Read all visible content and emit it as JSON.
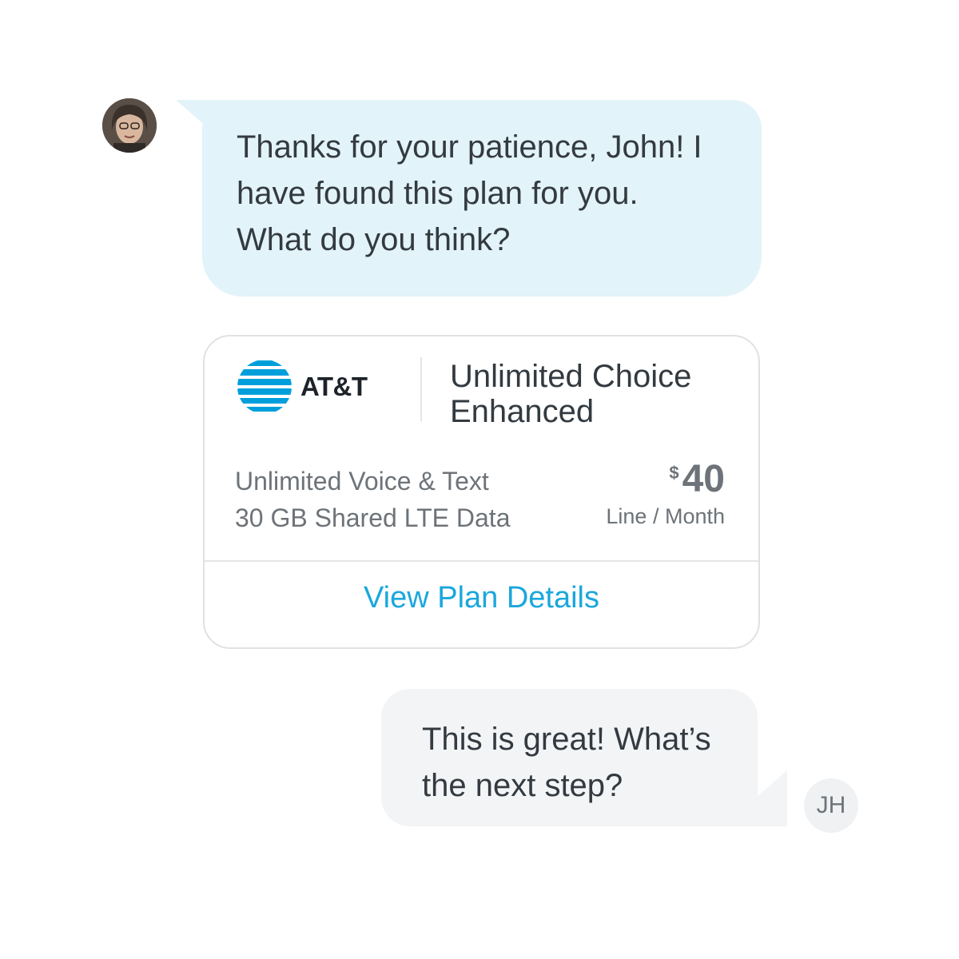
{
  "agent": {
    "avatar_icon": "agent-photo-avatar",
    "message": "Thanks for your patience, John! I have found this plan for you. What do you think?"
  },
  "plan_card": {
    "carrier_logo_icon": "att-globe-logo",
    "carrier_name": "AT&T",
    "plan_name": "Unlimited Choice Enhanced",
    "features": [
      "Unlimited Voice & Text",
      "30 GB Shared LTE Data"
    ],
    "price": {
      "currency": "$",
      "amount": "40",
      "unit": "Line / Month"
    },
    "details_link": "View Plan Details"
  },
  "user": {
    "message": "This is great! What’s the next step?",
    "initials": "JH"
  },
  "colors": {
    "agent_bubble": "#e2f3f9",
    "user_bubble": "#f3f4f6",
    "link": "#1aa7dd",
    "att_blue": "#009fdb"
  }
}
